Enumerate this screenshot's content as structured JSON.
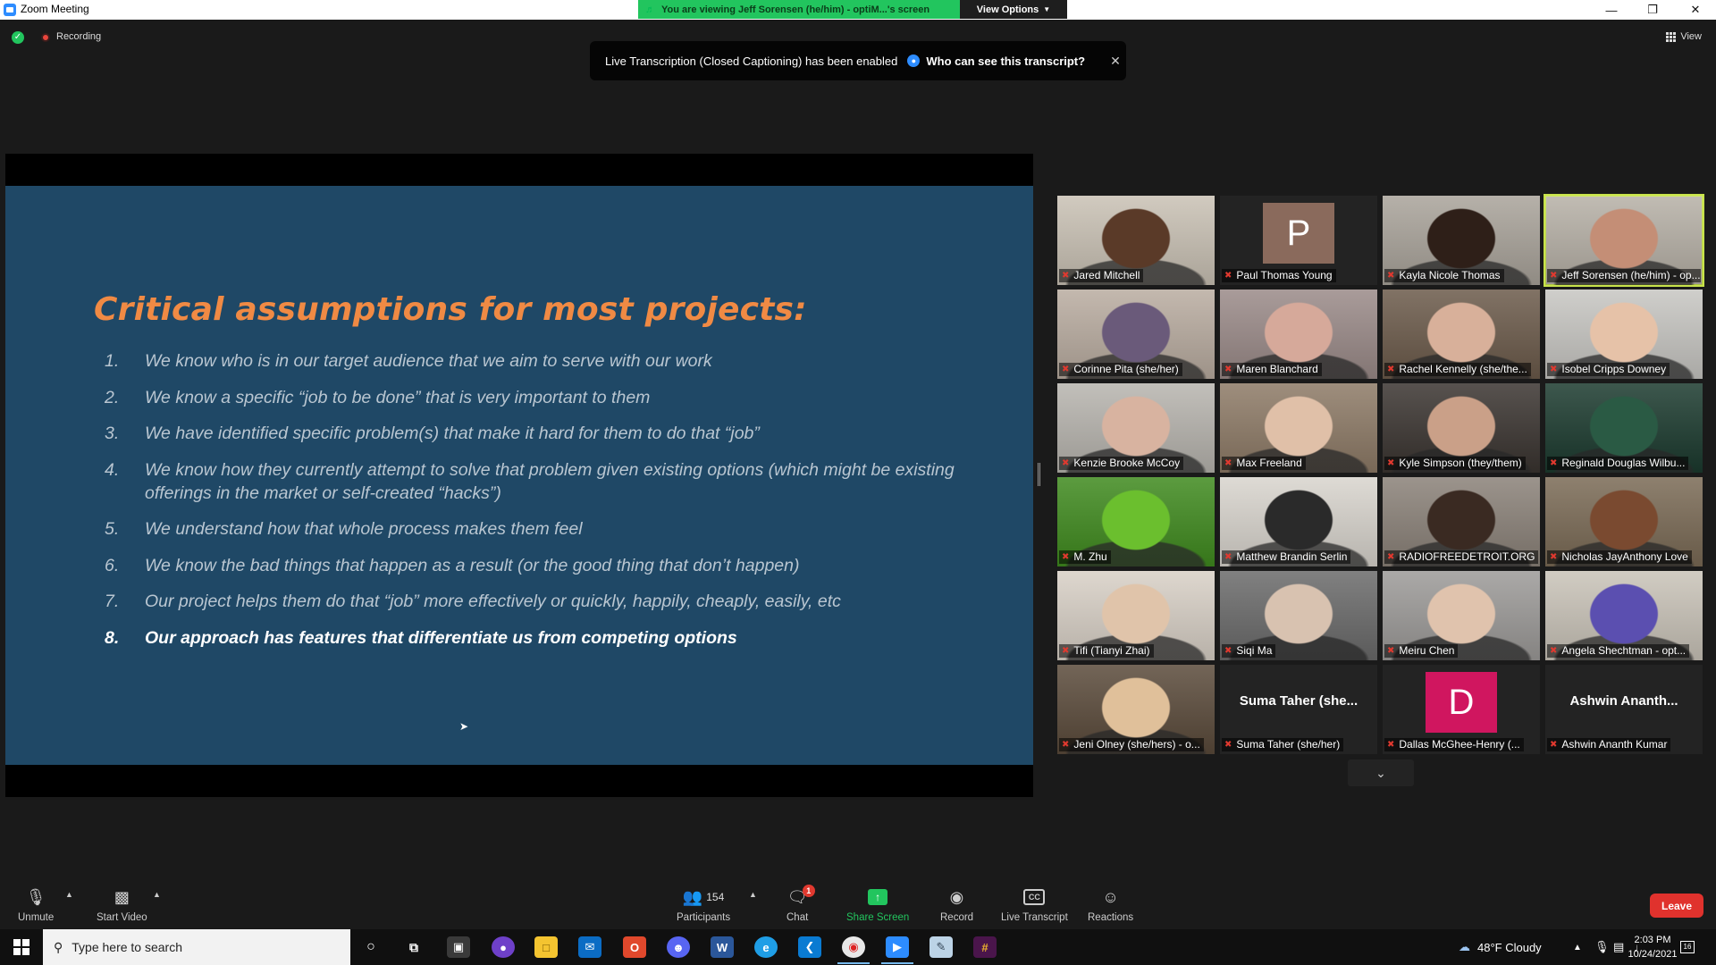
{
  "window": {
    "title": "Zoom Meeting",
    "share_banner": "You are viewing Jeff Sorensen (he/him) - optiM...'s screen",
    "view_options": "View Options",
    "minimize": "—",
    "maximize": "❐",
    "close": "✕"
  },
  "top": {
    "recording": "Recording",
    "view": "View"
  },
  "toast": {
    "message": "Live Transcription (Closed Captioning) has been enabled",
    "link": "Who can see this transcript?",
    "close": "✕"
  },
  "slide": {
    "title": "Critical assumptions for most projects:",
    "items": [
      {
        "num": "1.",
        "text": "We know who is in our target audience that we aim to serve with our work"
      },
      {
        "num": "2.",
        "text": "We know a specific “job to be done” that is very important to them"
      },
      {
        "num": "3.",
        "text": "We have identified specific problem(s) that make it hard for them to do that “job”"
      },
      {
        "num": "4.",
        "text": "We know how they currently attempt to solve that problem given existing options (which might be existing offerings in the market or self-created “hacks”)"
      },
      {
        "num": "5.",
        "text": "We understand how that whole process makes them feel"
      },
      {
        "num": "6.",
        "text": "We know the bad things that happen as a result (or the good thing that don’t happen)"
      },
      {
        "num": "7.",
        "text": "Our project helps them do that “job” more effectively or quickly, happily, cheaply, easily, etc"
      },
      {
        "num": "8.",
        "text": "Our approach has features that differentiate us from competing options"
      }
    ]
  },
  "participants": [
    {
      "name": "Jared Mitchell",
      "bg": "#c9c1b4",
      "skin": "#5a3a28"
    },
    {
      "name": "Paul Thomas Young",
      "letter": "P",
      "letter_bg": "#8a6a5c",
      "bg": "#232323"
    },
    {
      "name": "Kayla Nicole Thomas",
      "bg": "#a9a39a",
      "skin": "#2e1f18"
    },
    {
      "name": "Jeff Sorensen (he/him) - op...",
      "bg": "#b6b0a6",
      "skin": "#c48e76",
      "active": true
    },
    {
      "name": "Corinne Pita (she/her)",
      "bg": "#b9aca0",
      "skin": "#6a5a7a"
    },
    {
      "name": "Maren Blanchard",
      "bg": "#9a8a88",
      "skin": "#d6a99a"
    },
    {
      "name": "Rachel Kennelly (she/the...",
      "bg": "#6b5a4a",
      "skin": "#d8b09a"
    },
    {
      "name": "Isobel Cripps Downey",
      "bg": "#c7c6c2",
      "skin": "#e6c2a8"
    },
    {
      "name": "Kenzie Brooke McCoy",
      "bg": "#b7b4ae",
      "skin": "#d8b3a0"
    },
    {
      "name": "Max Freeland",
      "bg": "#8d7a66",
      "skin": "#e0c0a8"
    },
    {
      "name": "Kyle Simpson (they/them)",
      "bg": "#3a3430",
      "skin": "#caa088"
    },
    {
      "name": "Reginald Douglas Wilbu...",
      "bg": "#1b3a2e",
      "skin": "#2a5a44"
    },
    {
      "name": "M. Zhu",
      "bg": "#3f8a1e",
      "skin": "#6bbf2e"
    },
    {
      "name": "Matthew Brandin Serlin",
      "bg": "#d8d4cd",
      "skin": "#2a2a2a"
    },
    {
      "name": "RADIOFREEDETROIT.ORG",
      "bg": "#8a8178",
      "skin": "#3a2a22"
    },
    {
      "name": "Nicholas JayAnthony Love",
      "bg": "#7a6a55",
      "skin": "#7a4a30"
    },
    {
      "name": "Tifi (Tianyi Zhai)",
      "bg": "#d8d0c6",
      "skin": "#e0c4aa"
    },
    {
      "name": "Siqi Ma",
      "bg": "#6a6a6a",
      "skin": "#d8c2b0"
    },
    {
      "name": "Meiru Chen",
      "bg": "#9c9a98",
      "skin": "#e0c3ad"
    },
    {
      "name": "Angela Shechtman - opt...",
      "bg": "#c9c3b8",
      "skin": "#5b4fb0"
    },
    {
      "name": "Jeni Olney (she/hers) - o...",
      "bg": "#5a4a3a",
      "skin": "#e0c09a"
    },
    {
      "name": "Suma Taher (she/her)",
      "display": "Suma Taher (she...",
      "bg": "#232323"
    },
    {
      "name": "Dallas McGhee-Henry (...",
      "letter": "D",
      "letter_bg": "#d0165f",
      "bg": "#232323"
    },
    {
      "name": "Ashwin Ananth Kumar",
      "display": "Ashwin Ananth...",
      "bg": "#232323"
    }
  ],
  "toolbar": {
    "unmute": "Unmute",
    "start_video": "Start Video",
    "participants": "Participants",
    "participant_count": "154",
    "chat": "Chat",
    "chat_badge": "1",
    "share_screen": "Share Screen",
    "record": "Record",
    "live_transcript": "Live Transcript",
    "cc": "CC",
    "reactions": "Reactions",
    "leave": "Leave"
  },
  "taskbar": {
    "search_placeholder": "Type here to search",
    "weather": "48°F  Cloudy",
    "time": "2:03 PM",
    "date": "10/24/2021",
    "notifications": "16"
  }
}
